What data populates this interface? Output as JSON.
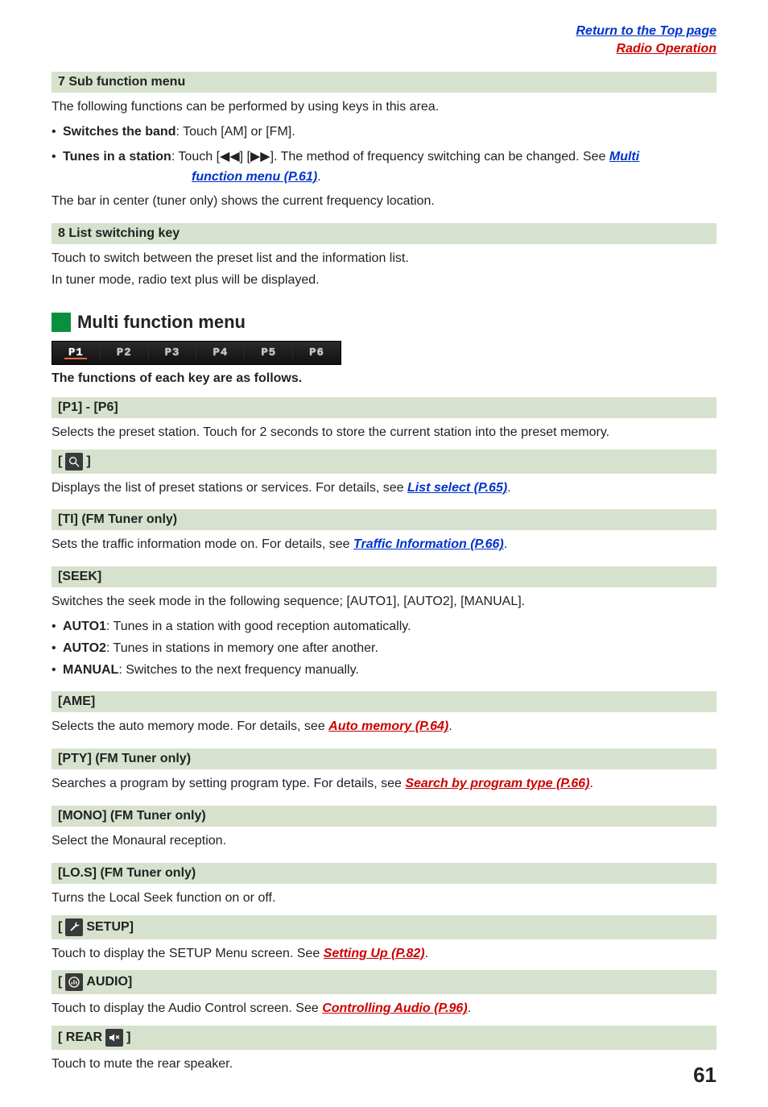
{
  "toplinks": {
    "l1": "Return to the Top page",
    "l2": "Radio Operation"
  },
  "sec7": {
    "title": "7  Sub function menu",
    "intro": "The following functions can be performed by using keys in this area.",
    "b1_pre": "• ",
    "b1_label": "Switches the band",
    "b1_rest": ": Touch [AM] or [FM].",
    "b2_pre": "• ",
    "b2_label": "Tunes in a station",
    "b2_rest_a": ": Touch [◀◀] [▶▶]. The method of frequency switching can be changed. See ",
    "b2_link1": "Multi",
    "b2_link2": "function menu (P.61)",
    "b2_rest_b": ".",
    "bar_note": "The bar in center (tuner only) shows the current frequency location."
  },
  "sec8": {
    "title": "8  List switching key",
    "l1": "Touch to switch between the preset list and the information list.",
    "l2": "In tuner mode, radio text plus will be displayed."
  },
  "multi": {
    "h2": "Multi function menu",
    "presets": [
      "P1",
      "P2",
      "P3",
      "P4",
      "P5",
      "P6"
    ],
    "intro": "The functions of each key are as follows."
  },
  "rows": {
    "p16": {
      "head": "[P1] - [P6]",
      "body": "Selects the preset station. Touch for 2 seconds to store the current station into the preset memory."
    },
    "search": {
      "head_open": "[ ",
      "head_close": " ]",
      "body_a": "Displays the list of preset stations or services. For details, see ",
      "link": "List select (P.65)",
      "body_b": "."
    },
    "ti": {
      "head": "[TI] (FM Tuner only)",
      "body_a": "Sets the traffic information mode on. For details, see  ",
      "link": "Traffic Information (P.66)",
      "body_b": "."
    },
    "seek": {
      "head": "[SEEK]",
      "l1": "Switches the seek mode in the following sequence; [AUTO1], [AUTO2], [MANUAL].",
      "b1_pre": "• ",
      "b1_label": "AUTO1",
      "b1_rest": ": Tunes in a station with good reception automatically.",
      "b2_pre": "• ",
      "b2_label": "AUTO2",
      "b2_rest": ": Tunes in stations in memory one after another.",
      "b3_pre": "• ",
      "b3_label": "MANUAL",
      "b3_rest": ": Switches to the next frequency manually."
    },
    "ame": {
      "head": "[AME]",
      "body_a": "Selects the auto memory mode. For details, see ",
      "link": "Auto memory (P.64)",
      "body_b": "."
    },
    "pty": {
      "head": "[PTY] (FM Tuner only)",
      "body_a": "Searches a program by setting program type. For details, see ",
      "link": "Search by program type (P.66)",
      "body_b": "."
    },
    "mono": {
      "head": "[MONO] (FM Tuner only)",
      "body": "Select the Monaural reception."
    },
    "los": {
      "head": "[LO.S] (FM Tuner only)",
      "body": "Turns the Local Seek function on or off."
    },
    "setup": {
      "head_open": "[ ",
      "head_label": " SETUP]",
      "body_a": "Touch to display the SETUP Menu screen. See ",
      "link": "Setting Up (P.82)",
      "body_b": "."
    },
    "audio": {
      "head_open": "[ ",
      "head_label": " AUDIO]",
      "body_a": "Touch to display the Audio Control screen. See ",
      "link": "Controlling Audio (P.96)",
      "body_b": "."
    },
    "rear": {
      "head_open": "[ REAR ",
      "head_close": " ]",
      "body": "Touch to mute the rear speaker."
    }
  },
  "pagenum": "61"
}
